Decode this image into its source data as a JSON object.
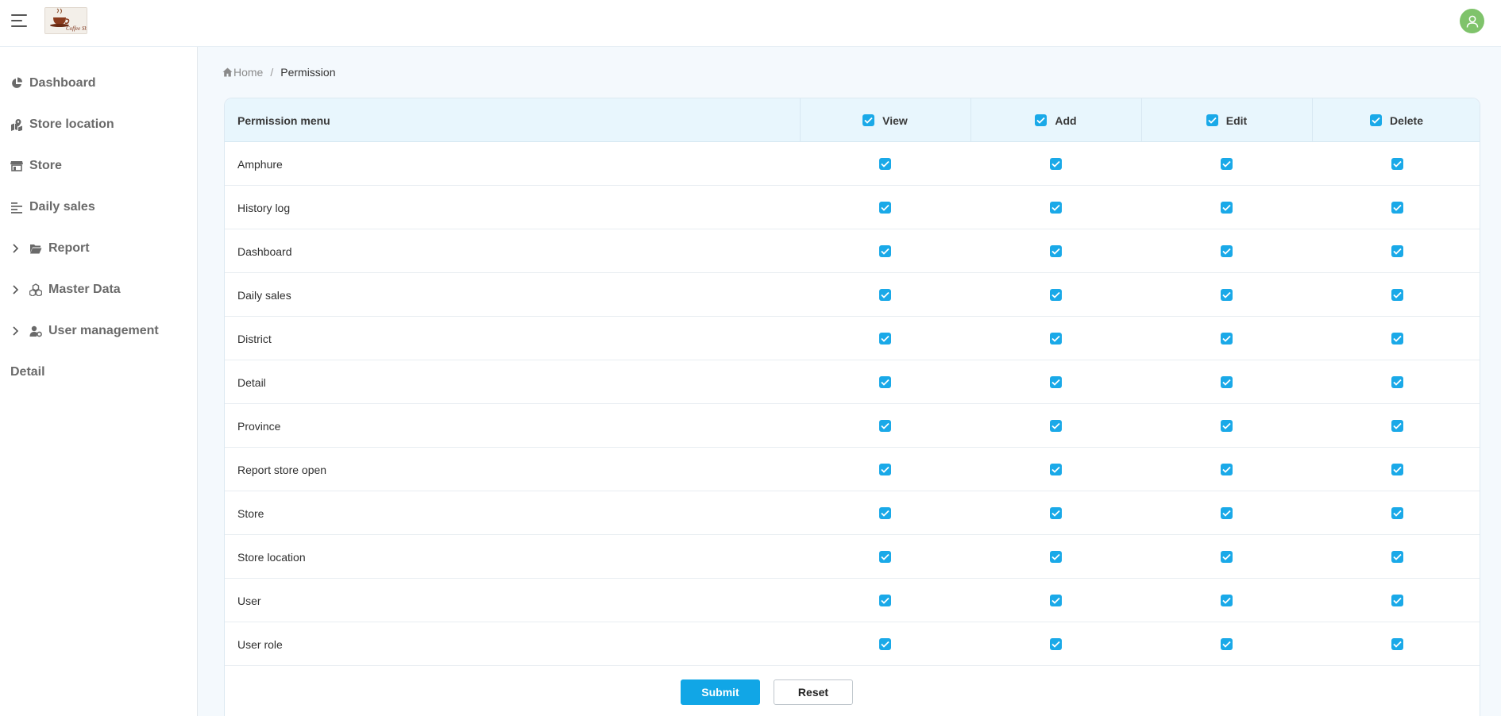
{
  "header": {
    "menu_icon": "hamburger-icon",
    "logo_text": "Coffee Shop",
    "user_icon": "user-icon"
  },
  "sidebar": {
    "items": [
      {
        "label": "Dashboard",
        "icon": "pie-chart-icon",
        "expandable": false
      },
      {
        "label": "Store location",
        "icon": "map-marker-icon",
        "expandable": false
      },
      {
        "label": "Store",
        "icon": "store-icon",
        "expandable": false
      },
      {
        "label": "Daily sales",
        "icon": "list-icon",
        "expandable": false
      },
      {
        "label": "Report",
        "icon": "folder-open-icon",
        "expandable": true
      },
      {
        "label": "Master Data",
        "icon": "cubes-icon",
        "expandable": true
      },
      {
        "label": "User management",
        "icon": "user-gear-icon",
        "expandable": true
      },
      {
        "label": "Detail",
        "icon": "",
        "expandable": false
      }
    ]
  },
  "breadcrumb": {
    "home": "Home",
    "separator": "/",
    "current": "Permission"
  },
  "table": {
    "headers": {
      "menu": "Permission menu",
      "view": "View",
      "add": "Add",
      "edit": "Edit",
      "delete": "Delete"
    },
    "header_checked": {
      "view": true,
      "add": true,
      "edit": true,
      "delete": true
    },
    "rows": [
      {
        "name": "Amphure",
        "view": true,
        "add": true,
        "edit": true,
        "delete": true
      },
      {
        "name": "History log",
        "view": true,
        "add": true,
        "edit": true,
        "delete": true
      },
      {
        "name": "Dashboard",
        "view": true,
        "add": true,
        "edit": true,
        "delete": true
      },
      {
        "name": "Daily sales",
        "view": true,
        "add": true,
        "edit": true,
        "delete": true
      },
      {
        "name": "District",
        "view": true,
        "add": true,
        "edit": true,
        "delete": true
      },
      {
        "name": "Detail",
        "view": true,
        "add": true,
        "edit": true,
        "delete": true
      },
      {
        "name": "Province",
        "view": true,
        "add": true,
        "edit": true,
        "delete": true
      },
      {
        "name": "Report store open",
        "view": true,
        "add": true,
        "edit": true,
        "delete": true
      },
      {
        "name": "Store",
        "view": true,
        "add": true,
        "edit": true,
        "delete": true
      },
      {
        "name": "Store location",
        "view": true,
        "add": true,
        "edit": true,
        "delete": true
      },
      {
        "name": "User",
        "view": true,
        "add": true,
        "edit": true,
        "delete": true
      },
      {
        "name": "User role",
        "view": true,
        "add": true,
        "edit": true,
        "delete": true
      }
    ]
  },
  "actions": {
    "submit": "Submit",
    "reset": "Reset"
  },
  "colors": {
    "accent": "#11a6e6",
    "checkbox": "#1aa9e8",
    "header_bg": "#e8f6fd",
    "page_bg": "#f4f9fd",
    "avatar": "#7fc36b"
  }
}
